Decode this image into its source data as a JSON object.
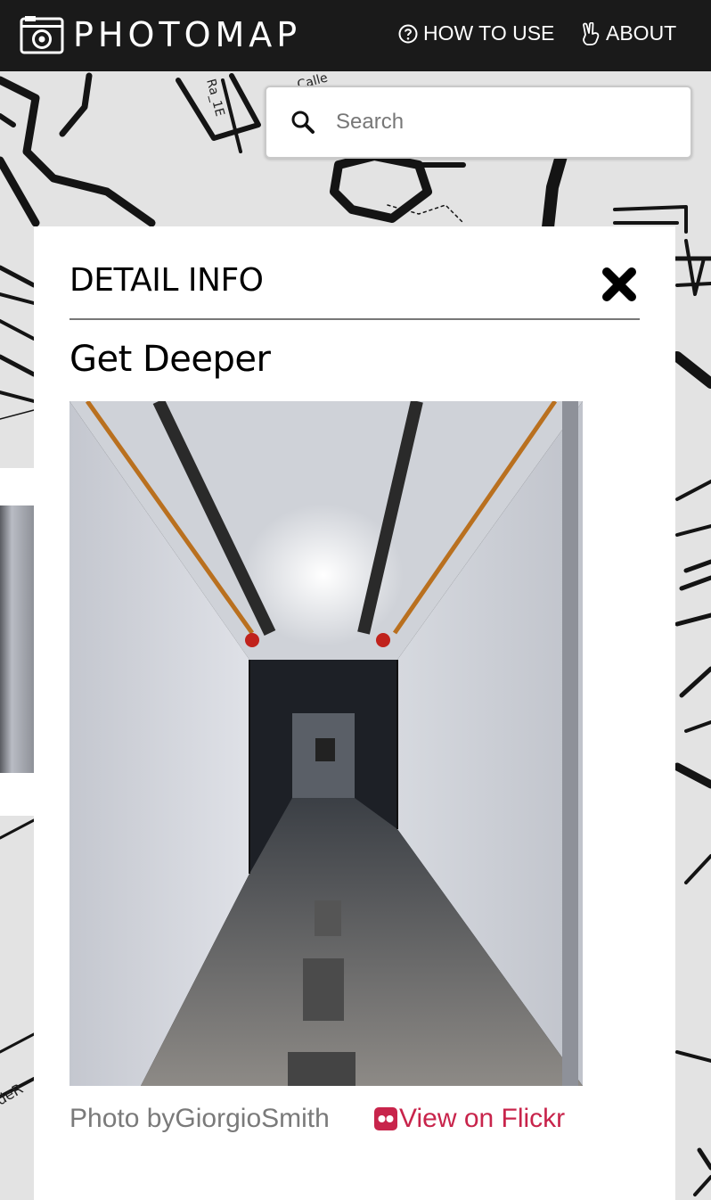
{
  "header": {
    "app_name": "PHOTOMAP",
    "nav": [
      {
        "label": "HOW TO USE",
        "icon": "question-circle-icon"
      },
      {
        "label": "ABOUT",
        "icon": "hand-peace-icon"
      }
    ]
  },
  "search": {
    "placeholder": "Search",
    "icon": "search-icon"
  },
  "map": {
    "street_labels": [
      "Calle",
      "Ra_1E",
      "deR"
    ]
  },
  "detail": {
    "heading": "DETAIL INFO",
    "photo_title": "Get Deeper",
    "photo_alt": "Get Deeper",
    "credit_prefix": "Photo by",
    "credit_author": "GiorgioSmith",
    "flickr_label": "View on Flickr",
    "flickr_color": "#c8244b"
  }
}
